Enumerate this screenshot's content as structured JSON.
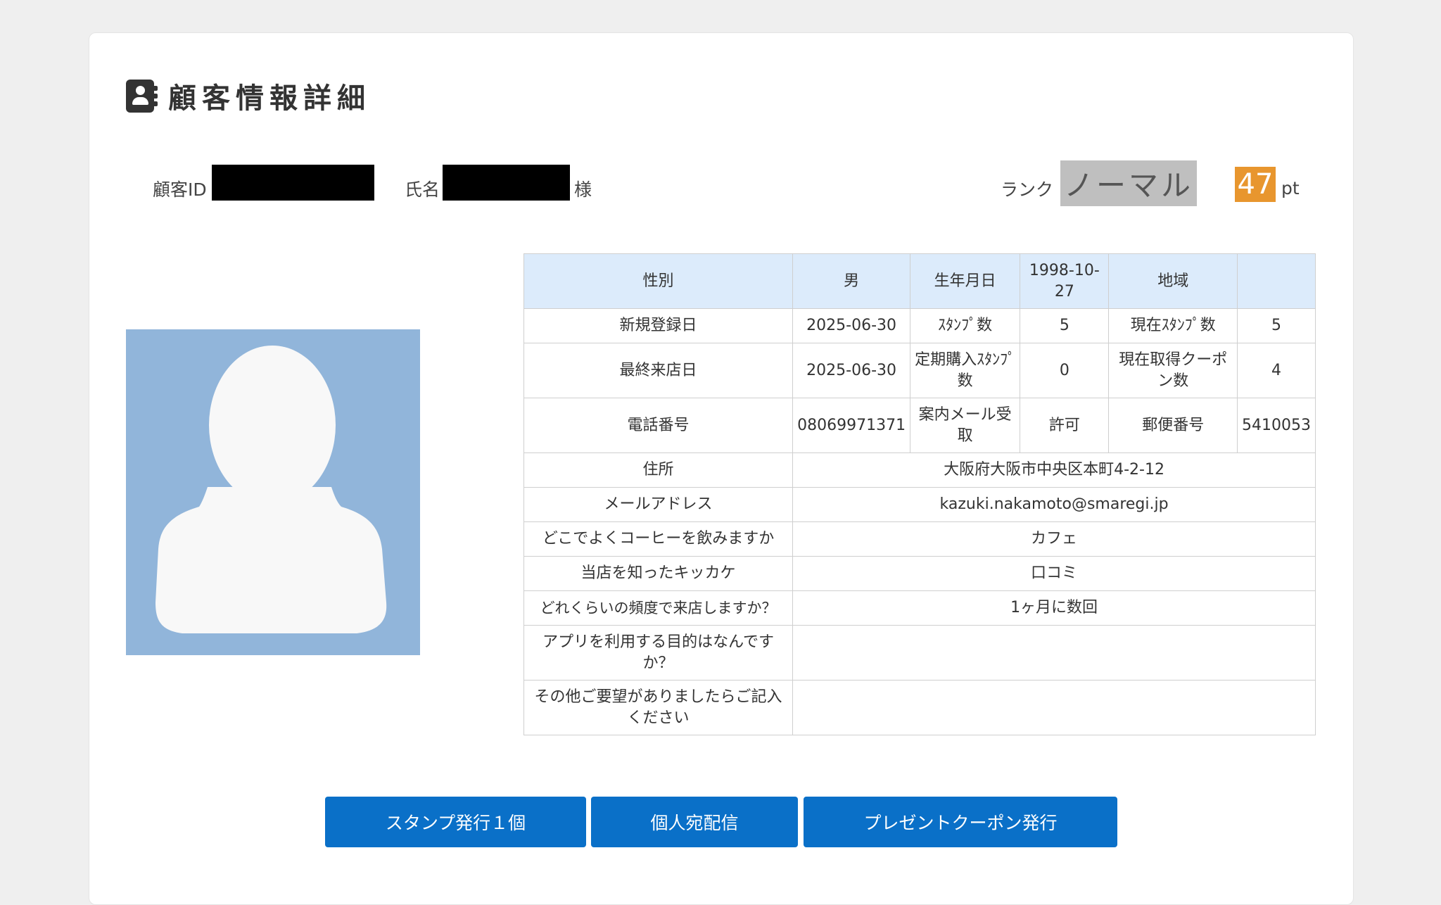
{
  "page": {
    "title": "顧客情報詳細",
    "customer_id_label": "顧客ID",
    "name_label": "氏名",
    "name_suffix": "様",
    "rank_label": "ランク",
    "rank_value": "ノーマル",
    "points_value": "47",
    "points_unit": "pt"
  },
  "table": {
    "gender_label": "性別",
    "gender_value": "男",
    "birthday_label": "生年月日",
    "birthday_value": "1998-10-27",
    "region_label": "地域",
    "region_value": "",
    "registered_label": "新規登録日",
    "registered_value": "2025-06-30",
    "stamps_label": "ｽﾀﾝﾌﾟ数",
    "stamps_value": "5",
    "current_stamps_label": "現在ｽﾀﾝﾌﾟ数",
    "current_stamps_value": "5",
    "last_visit_label": "最終来店日",
    "last_visit_value": "2025-06-30",
    "sub_stamps_label": "定期購入ｽﾀﾝﾌﾟ数",
    "sub_stamps_value": "0",
    "coupons_label": "現在取得クーポン数",
    "coupons_value": "4",
    "phone_label": "電話番号",
    "phone_value": "08069971371",
    "mail_consent_label": "案内メール受取",
    "mail_consent_value": "許可",
    "postal_label": "郵便番号",
    "postal_value": "5410053",
    "address_label": "住所",
    "address_value": "大阪府大阪市中央区本町4-2-12",
    "email_label": "メールアドレス",
    "email_value": "kazuki.nakamoto@smaregi.jp",
    "q1_label": "どこでよくコーヒーを飲みますか",
    "q1_value": "カフェ",
    "q2_label": "当店を知ったキッカケ",
    "q2_value": "口コミ",
    "q3_label": "どれくらいの頻度で来店しますか？",
    "q3_value": "1ヶ月に数回",
    "q4_label": "アプリを利用する目的はなんですか？",
    "q4_value": "",
    "q5_label": "その他ご要望がありましたらご記入ください",
    "q5_value": ""
  },
  "buttons": {
    "stamp": "スタンプ発行１個",
    "message": "個人宛配信",
    "coupon": "プレゼントクーポン発行"
  }
}
